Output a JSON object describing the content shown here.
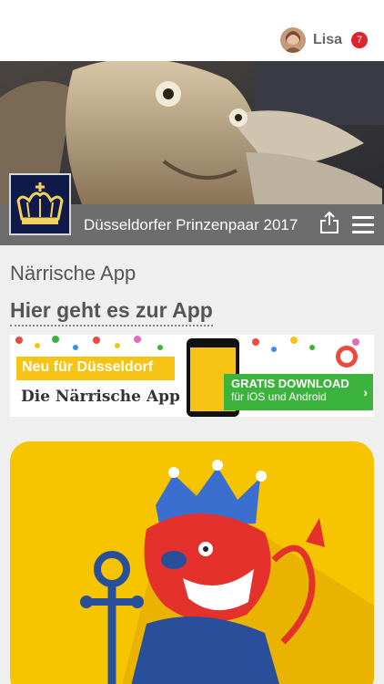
{
  "header": {
    "user_name": "Lisa",
    "notification_count": "7",
    "title": "Düsseldorfer Prinzenpaar 2017"
  },
  "content": {
    "section_title": "Närrische App",
    "link_text": "Hier geht es zur App"
  },
  "banner": {
    "headline": "Neu für Düsseldorf",
    "subline": "Die Närrische App",
    "download_title": "GRATIS DOWNLOAD",
    "download_sub": "für iOS und Android",
    "arrow": "›"
  },
  "colors": {
    "badge": "#e2222b",
    "hero_bar": "#6d6d6d",
    "banner_yellow": "#f7c416",
    "download_green": "#3bb33c",
    "tile_yellow": "#f7c400"
  }
}
